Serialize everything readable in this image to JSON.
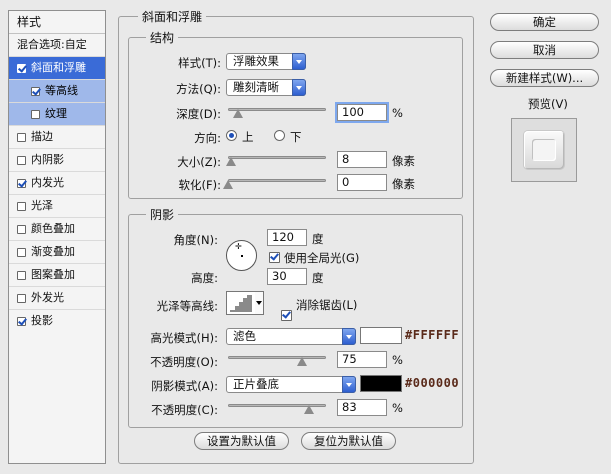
{
  "left_panel": {
    "header": "样式",
    "blend_options": "混合选项:自定",
    "items": [
      {
        "label": "斜面和浮雕",
        "checked": true
      },
      {
        "label": "等高线",
        "checked": true
      },
      {
        "label": "纹理",
        "checked": false
      },
      {
        "label": "描边",
        "checked": false
      },
      {
        "label": "内阴影",
        "checked": false
      },
      {
        "label": "内发光",
        "checked": true
      },
      {
        "label": "光泽",
        "checked": false
      },
      {
        "label": "颜色叠加",
        "checked": false
      },
      {
        "label": "渐变叠加",
        "checked": false
      },
      {
        "label": "图案叠加",
        "checked": false
      },
      {
        "label": "外发光",
        "checked": false
      },
      {
        "label": "投影",
        "checked": true
      }
    ]
  },
  "bevel": {
    "title": "斜面和浮雕",
    "structure": {
      "title": "结构",
      "style_label": "样式(T):",
      "style_value": "浮雕效果",
      "technique_label": "方法(Q):",
      "technique_value": "雕刻清晰",
      "depth_label": "深度(D):",
      "depth_value": "100",
      "depth_unit": "%",
      "depth_slider": 0.1,
      "direction_label": "方向:",
      "direction_up": "上",
      "direction_down": "下",
      "size_label": "大小(Z):",
      "size_value": "8",
      "size_unit": "像素",
      "size_slider": 0.03,
      "soften_label": "软化(F):",
      "soften_value": "0",
      "soften_unit": "像素",
      "soften_slider": 0.0
    },
    "shading": {
      "title": "阴影",
      "angle_label": "角度(N):",
      "angle_value": "120",
      "angle_unit": "度",
      "global_light_label": "使用全局光(G)",
      "altitude_label": "高度:",
      "altitude_value": "30",
      "altitude_unit": "度",
      "gloss_label": "光泽等高线:",
      "antialias_label": "消除锯齿(L)",
      "highlight_mode_label": "高光模式(H):",
      "highlight_mode_value": "滤色",
      "highlight_color": "#FFFFFF",
      "highlight_opacity_label": "不透明度(O):",
      "highlight_opacity_value": "75",
      "highlight_opacity_unit": "%",
      "highlight_slider": 0.75,
      "shadow_mode_label": "阴影模式(A):",
      "shadow_mode_value": "正片叠底",
      "shadow_color": "#000000",
      "shadow_opacity_label": "不透明度(C):",
      "shadow_opacity_value": "83",
      "shadow_opacity_unit": "%",
      "shadow_slider": 0.83
    },
    "make_default": "设置为默认值",
    "reset_default": "复位为默认值"
  },
  "buttons": {
    "ok": "确定",
    "cancel": "取消",
    "new_style": "新建样式(W)...",
    "preview_label": "预览(V)"
  }
}
